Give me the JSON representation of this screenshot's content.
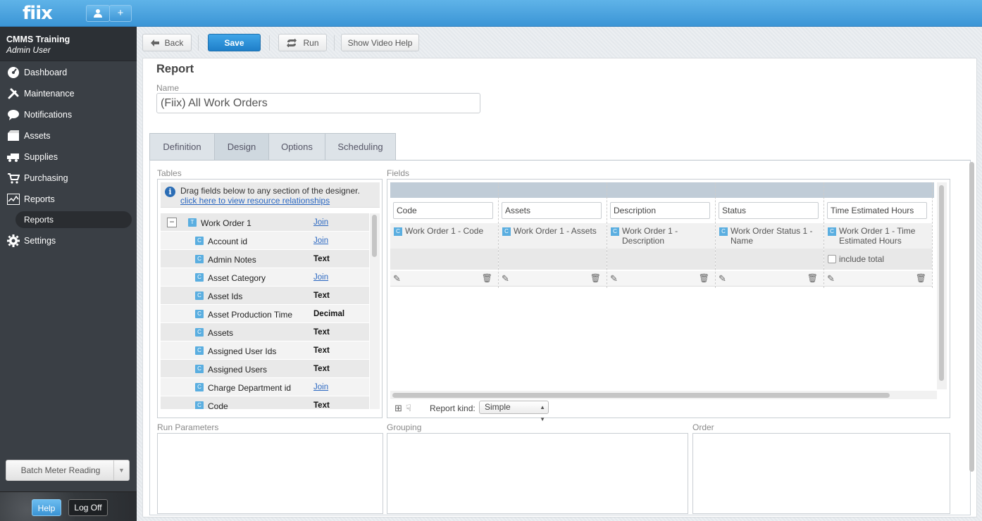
{
  "app": {
    "logo": "fiix"
  },
  "topbar": {
    "user_icon": "user-icon",
    "add_icon": "plus-icon"
  },
  "sidebar": {
    "company": "CMMS Training",
    "user": "Admin User",
    "items": [
      {
        "label": "Dashboard",
        "icon": "dashboard-icon"
      },
      {
        "label": "Maintenance",
        "icon": "tools-icon"
      },
      {
        "label": "Notifications",
        "icon": "speech-bubble-icon"
      },
      {
        "label": "Assets",
        "icon": "boxes-icon"
      },
      {
        "label": "Supplies",
        "icon": "truck-icon"
      },
      {
        "label": "Purchasing",
        "icon": "cart-icon"
      },
      {
        "label": "Reports",
        "icon": "chart-icon"
      }
    ],
    "sub_item": "Reports",
    "settings": "Settings",
    "batch_meter": "Batch Meter Reading",
    "help": "Help",
    "logoff": "Log Off"
  },
  "toolbar": {
    "back": "Back",
    "save": "Save",
    "run": "Run",
    "video_help": "Show Video Help"
  },
  "report": {
    "title": "Report",
    "name_label": "Name",
    "name_value": "(Fiix) All Work Orders"
  },
  "tabs": [
    "Definition",
    "Design",
    "Options",
    "Scheduling"
  ],
  "sections": {
    "tables": "Tables",
    "fields": "Fields",
    "run_parameters": "Run Parameters",
    "grouping": "Grouping",
    "order": "Order"
  },
  "tables_info": {
    "text": "Drag fields below to any section of the designer.",
    "link": "click here to view resource relationships"
  },
  "tree": {
    "root": {
      "name": "Work Order 1",
      "tag": "Join",
      "icon_letter": "T"
    },
    "fields": [
      {
        "name": "Account id",
        "tag": "Join",
        "link": true
      },
      {
        "name": "Admin Notes",
        "tag": "Text",
        "link": false
      },
      {
        "name": "Asset Category",
        "tag": "Join",
        "link": true
      },
      {
        "name": "Asset Ids",
        "tag": "Text",
        "link": false
      },
      {
        "name": "Asset Production Time",
        "tag": "Decimal",
        "link": false
      },
      {
        "name": "Assets",
        "tag": "Text",
        "link": false
      },
      {
        "name": "Assigned User Ids",
        "tag": "Text",
        "link": false
      },
      {
        "name": "Assigned Users",
        "tag": "Text",
        "link": false
      },
      {
        "name": "Charge Department id",
        "tag": "Join",
        "link": true
      },
      {
        "name": "Code",
        "tag": "Text",
        "link": false
      }
    ],
    "field_icon_letter": "C"
  },
  "fields": {
    "columns": [
      {
        "header": "Code",
        "source": "Work Order 1 - Code",
        "has_total": false
      },
      {
        "header": "Assets",
        "source": "Work Order 1 - Assets",
        "has_total": false
      },
      {
        "header": "Description",
        "source": "Work Order 1 - Description",
        "has_total": false
      },
      {
        "header": "Status",
        "source": "Work Order Status 1 - Name",
        "has_total": false
      },
      {
        "header": "Time Estimated Hours",
        "source": "Work Order 1 - Time Estimated Hours",
        "has_total": true
      }
    ],
    "include_total_label": "include total",
    "report_kind_label": "Report kind:",
    "report_kind_value": "Simple"
  }
}
